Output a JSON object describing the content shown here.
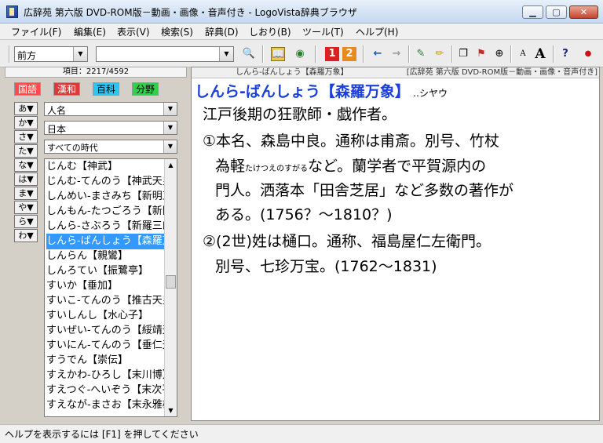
{
  "window": {
    "title": "広辞苑 第六版 DVD-ROM版－動画・画像・音声付き - LogoVista辞典ブラウザ",
    "min_glyph": "▁",
    "max_glyph": "▢",
    "close_glyph": "✕"
  },
  "menu": [
    "ファイル(F)",
    "編集(E)",
    "表示(V)",
    "検索(S)",
    "辞典(D)",
    "しおり(B)",
    "ツール(T)",
    "ヘルプ(H)"
  ],
  "toolbar": {
    "search_mode": "前方",
    "search_text": "",
    "icons": {
      "binoculars": "🔍",
      "dict": "📖",
      "cd": "◉",
      "num1": "1",
      "num2": "2",
      "back": "←",
      "forward": "→",
      "pen": "✎",
      "marker": "✏",
      "copy": "❐",
      "flag": "⚑",
      "zoom": "⊕",
      "font_small": "A",
      "font_large": "A",
      "help": "?",
      "record": "●"
    }
  },
  "left": {
    "item_count": "項目：2217/4592",
    "tabs": [
      "国語",
      "漢和",
      "百科",
      "分野"
    ],
    "kana": [
      "あ▼",
      "か▼",
      "さ▼",
      "た▼",
      "な▼",
      "は▼",
      "ま▼",
      "や▼",
      "ら▼",
      "わ▼"
    ],
    "filters": [
      "人名",
      "日本",
      "すべての時代"
    ],
    "words": [
      "じんむ【神武】",
      "じんむ-てんのう【神武天皇】",
      "しんめい-まさみち【新明正道】",
      "しんもん-たつごろう【新門辰五郎】",
      "しんら-さぶろう【新羅三郎】",
      "しんら-ばんしょう【森羅万象】",
      "しんらん【親鸞】",
      "しんろてい【振鷺亭】",
      "すいか【垂加】",
      "すいこ-てんのう【推古天皇】",
      "すいしんし【水心子】",
      "すいぜい-てんのう【綏靖天皇】",
      "すいにん-てんのう【垂仁天皇】",
      "すうでん【崇伝】",
      "すえかわ-ひろし【末川博】",
      "すえつぐ-へいぞう【末次平蔵】",
      "すえなが-まさお【末永雅雄】"
    ],
    "selected_index": 5
  },
  "right": {
    "header_entry": "しんら-ばんしょう【森羅万象】",
    "header_dict": "[広辞苑 第六版 DVD-ROM版－動画・画像・音声付き]",
    "headword_kana": "しんら-ばんしょう",
    "headword_kanji": "【森羅万象】",
    "reading": "‥シヤウ",
    "line1": "江戸後期の狂歌師・戯作者。",
    "line2": "①本名、森島中良。通称は甫斎。別号、竹杖",
    "line3_a": "為軽",
    "line3_ruby": "たけつえのすがる",
    "line3_b": "など。蘭学者で平賀源内の",
    "line4": "門人。洒落本「田舎芝居」など多数の著作が",
    "line5": "ある。(1756？～1810？)",
    "line6": "②(2世)姓は樋口。通称、福島屋仁左衛門。",
    "line7": "別号、七珍万宝。(1762～1831)"
  },
  "status": "ヘルプを表示するには [F1] を押してください",
  "colors": {
    "tab_kokugo": "#ff4b4b",
    "tab_kanwa": "#d93a3a",
    "tab_hyakka": "#29c7f2",
    "tab_bunya": "#2fd04a",
    "headword": "#1a3fdd",
    "selection": "#3399ff"
  }
}
